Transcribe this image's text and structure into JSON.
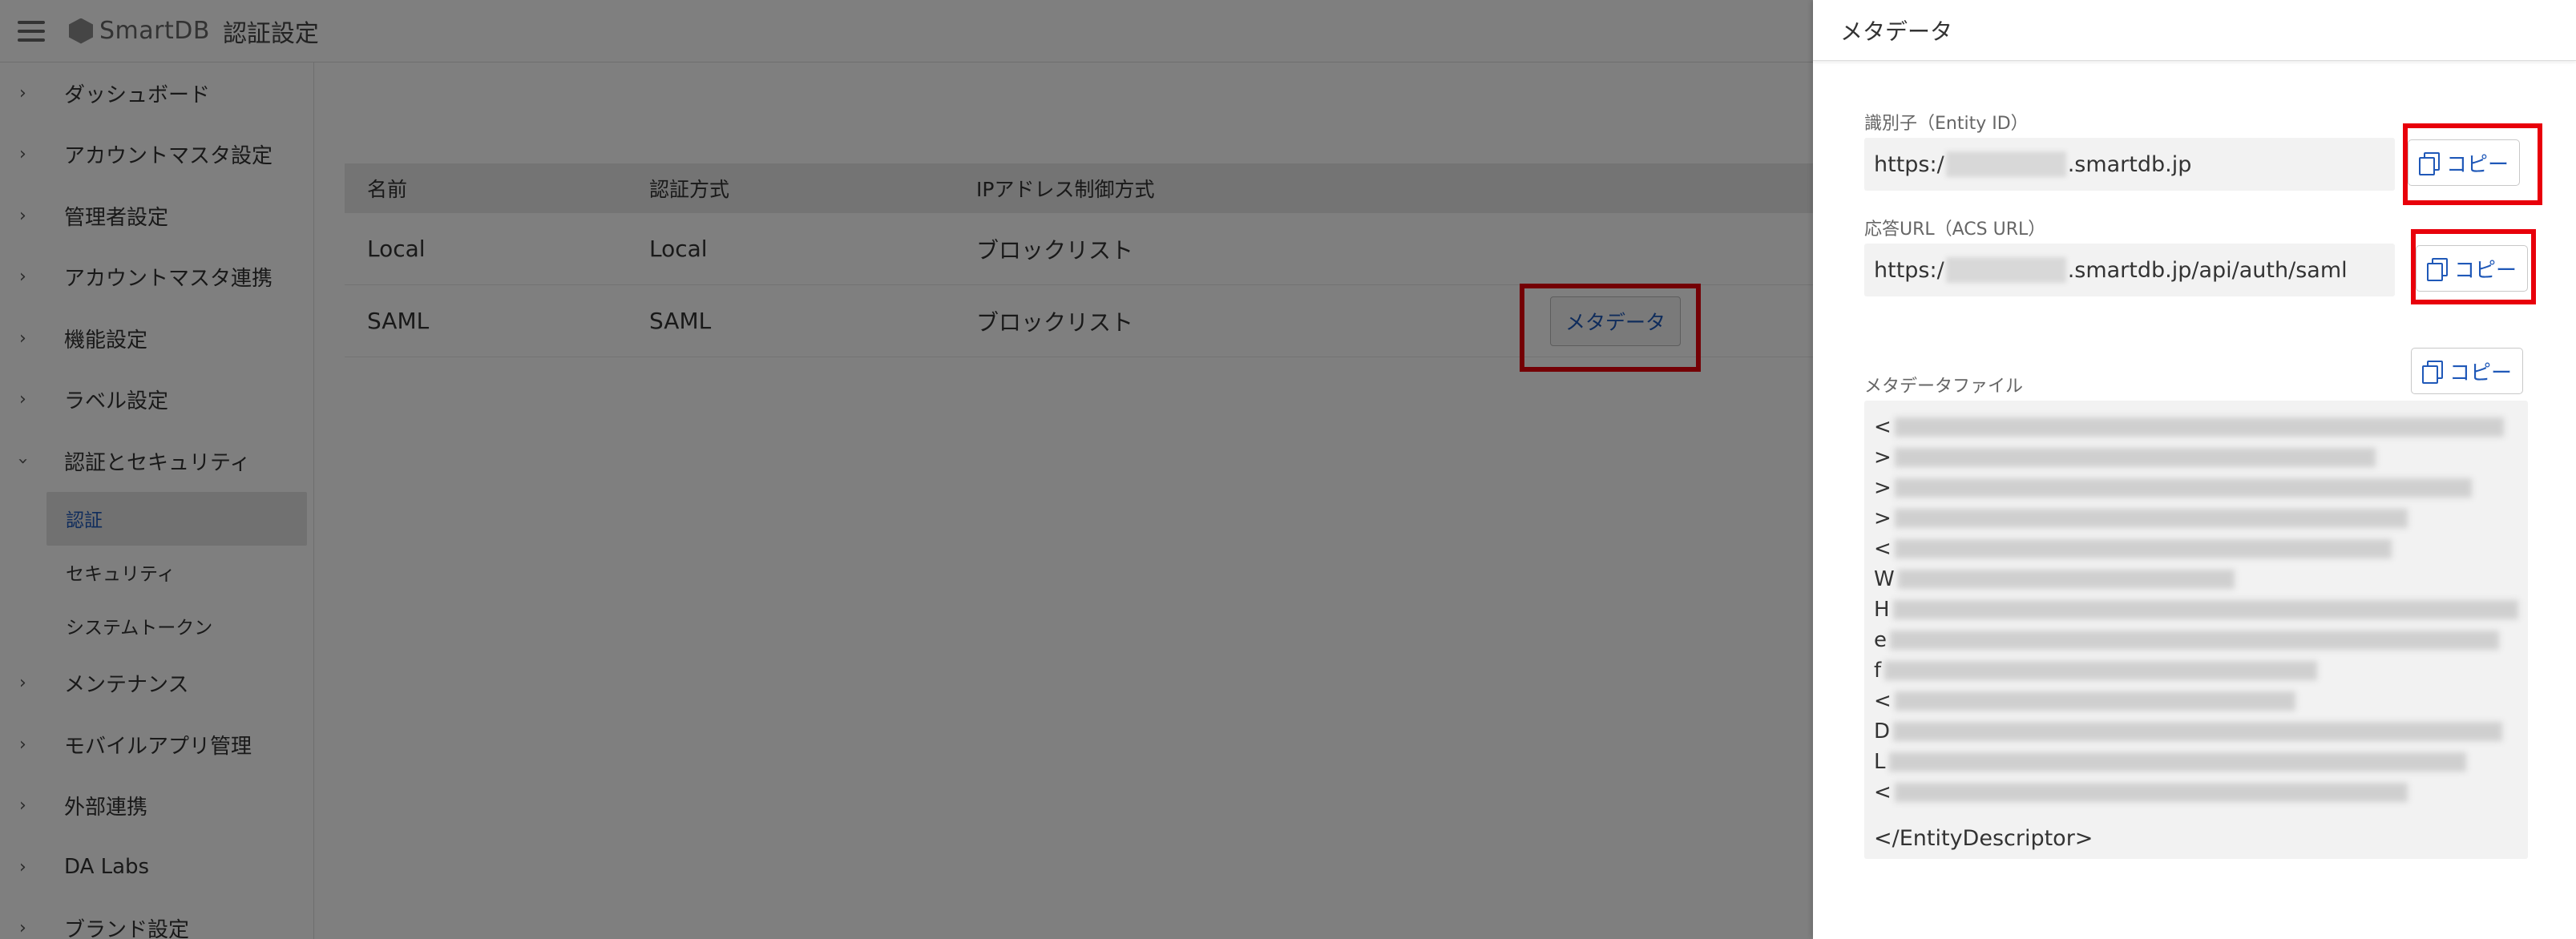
{
  "header": {
    "logo_text": "SmartDB",
    "page_title": "認証設定"
  },
  "sidebar": {
    "items": [
      {
        "label": "ダッシュボード"
      },
      {
        "label": "アカウントマスタ設定"
      },
      {
        "label": "管理者設定"
      },
      {
        "label": "アカウントマスタ連携"
      },
      {
        "label": "機能設定"
      },
      {
        "label": "ラベル設定"
      },
      {
        "label": "認証とセキュリティ"
      },
      {
        "label": "メンテナンス"
      },
      {
        "label": "モバイルアプリ管理"
      },
      {
        "label": "外部連携"
      },
      {
        "label": "DA Labs"
      },
      {
        "label": "ブランド設定"
      }
    ],
    "sub_items": [
      {
        "label": "認証"
      },
      {
        "label": "セキュリティ"
      },
      {
        "label": "システムトークン"
      }
    ]
  },
  "table": {
    "headers": [
      "名前",
      "認証方式",
      "IPアドレス制御方式"
    ],
    "rows": [
      {
        "name": "Local",
        "method": "Local",
        "ip_control": "ブロックリスト"
      },
      {
        "name": "SAML",
        "method": "SAML",
        "ip_control": "ブロックリスト",
        "action": "メタデータ"
      }
    ]
  },
  "drawer": {
    "title": "メタデータ",
    "entity_id_label": "識別子（Entity ID）",
    "entity_id_prefix": "https:/",
    "entity_id_suffix": ".smartdb.jp",
    "acs_url_label": "応答URL（ACS URL）",
    "acs_url_prefix": "https:/",
    "acs_url_suffix": ".smartdb.jp/api/auth/saml",
    "copy_label": "コピー",
    "metadata_file_label": "メタデータファイル",
    "metadata_line_prefixes": [
      "<",
      ">",
      ">",
      ">",
      "<",
      "W",
      "H",
      "e",
      "f",
      "<",
      "D",
      "L",
      "<"
    ],
    "metadata_end": "</EntityDescriptor>"
  },
  "colors": {
    "accent": "#1f58b8",
    "highlight": "#e8000b"
  },
  "icons": {
    "menu": "hamburger-icon",
    "copy": "copy-icon",
    "chevron": "chevron-right-icon"
  }
}
